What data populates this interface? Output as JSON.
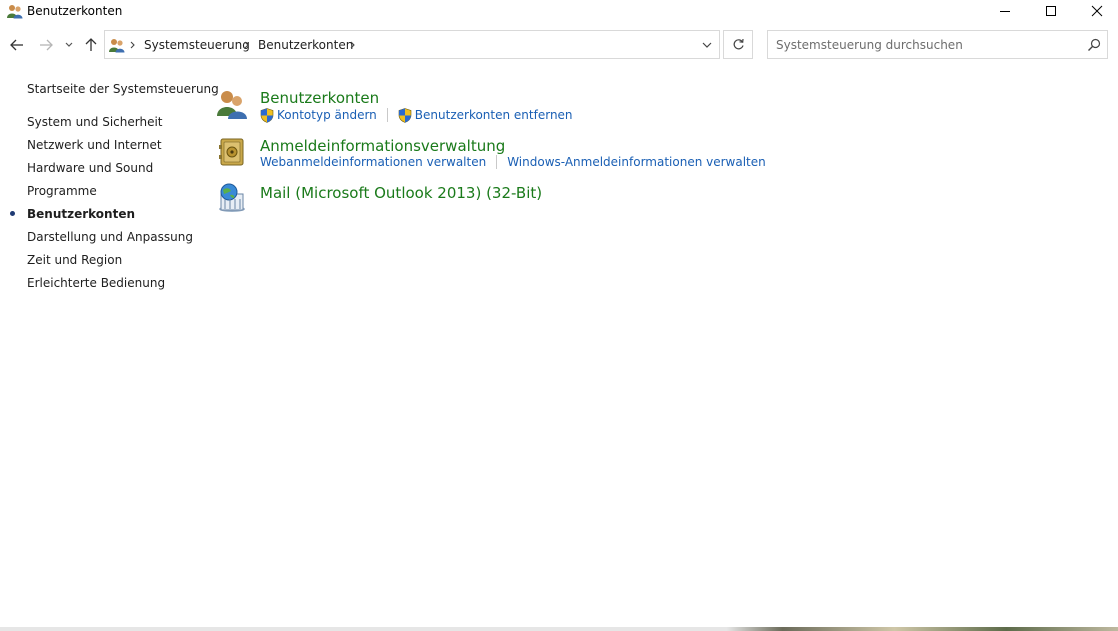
{
  "window": {
    "title": "Benutzerkonten",
    "minimize_symbol": "—",
    "maximize_symbol": "☐",
    "close_symbol": "✕"
  },
  "navigation": {
    "back_icon": "arrow-left-icon",
    "forward_icon": "arrow-right-icon",
    "recent_icon": "chevron-down-icon",
    "up_icon": "arrow-up-icon"
  },
  "address": {
    "breadcrumbs": [
      "Systemsteuerung",
      "Benutzerkonten"
    ],
    "refresh_icon": "refresh-icon"
  },
  "search": {
    "placeholder": "Systemsteuerung durchsuchen"
  },
  "sidebar": {
    "home_label": "Startseite der Systemsteuerung",
    "items": [
      {
        "label": "System und Sicherheit",
        "active": false
      },
      {
        "label": "Netzwerk und Internet",
        "active": false
      },
      {
        "label": "Hardware und Sound",
        "active": false
      },
      {
        "label": "Programme",
        "active": false
      },
      {
        "label": "Benutzerkonten",
        "active": true
      },
      {
        "label": "Darstellung und Anpassung",
        "active": false
      },
      {
        "label": "Zeit und Region",
        "active": false
      },
      {
        "label": "Erleichterte Bedienung",
        "active": false
      }
    ]
  },
  "main": {
    "categories": [
      {
        "title": "Benutzerkonten",
        "icon": "user-accounts-icon",
        "links": [
          {
            "label": "Kontotyp ändern",
            "shield": true
          },
          {
            "label": "Benutzerkonten entfernen",
            "shield": true
          }
        ]
      },
      {
        "title": "Anmeldeinformationsverwaltung",
        "icon": "credential-vault-icon",
        "links": [
          {
            "label": "Webanmeldeinformationen verwalten",
            "shield": false
          },
          {
            "label": "Windows-Anmeldeinformationen verwalten",
            "shield": false
          }
        ]
      },
      {
        "title": "Mail (Microsoft Outlook 2013) (32-Bit)",
        "icon": "mail-icon",
        "links": []
      }
    ]
  },
  "colors": {
    "category_title": "#1a7a1a",
    "link": "#1a5fb4",
    "text": "#1e1e1e"
  }
}
